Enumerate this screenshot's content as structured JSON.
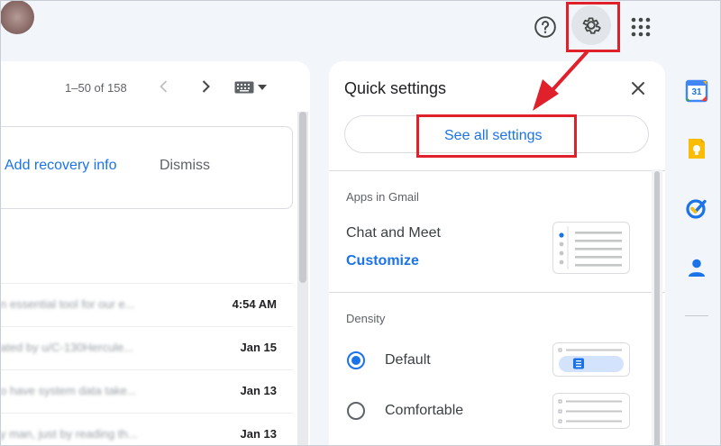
{
  "header": {
    "help_icon": "help-circle-icon",
    "settings_icon": "gear-icon",
    "apps_icon": "apps-grid-icon",
    "avatar_color": "#8e6f6b"
  },
  "mail": {
    "pagination": "1–50 of 158",
    "recovery": {
      "link": "Add recovery info",
      "dismiss": "Dismiss"
    },
    "rows": [
      {
        "snippet": "n essential tool for our e...",
        "date": "4:54 AM"
      },
      {
        "snippet": "ated by u/C-130Hercule...",
        "date": "Jan 15"
      },
      {
        "snippet": "o have system data take...",
        "date": "Jan 13"
      },
      {
        "snippet": "y man, just by reading th...",
        "date": "Jan 13"
      }
    ]
  },
  "quick_settings": {
    "title": "Quick settings",
    "see_all": "See all settings",
    "apps_section": "Apps in Gmail",
    "chat_meet": "Chat and Meet",
    "customize": "Customize",
    "density_section": "Density",
    "density_options": [
      {
        "label": "Default",
        "selected": true
      },
      {
        "label": "Comfortable",
        "selected": false
      }
    ]
  },
  "side_rail": {
    "calendar_day": "31",
    "icons": [
      "calendar-icon",
      "keep-icon",
      "tasks-icon",
      "contacts-icon"
    ]
  },
  "colors": {
    "accent": "#1a73e8",
    "highlight": "#e0202a"
  }
}
